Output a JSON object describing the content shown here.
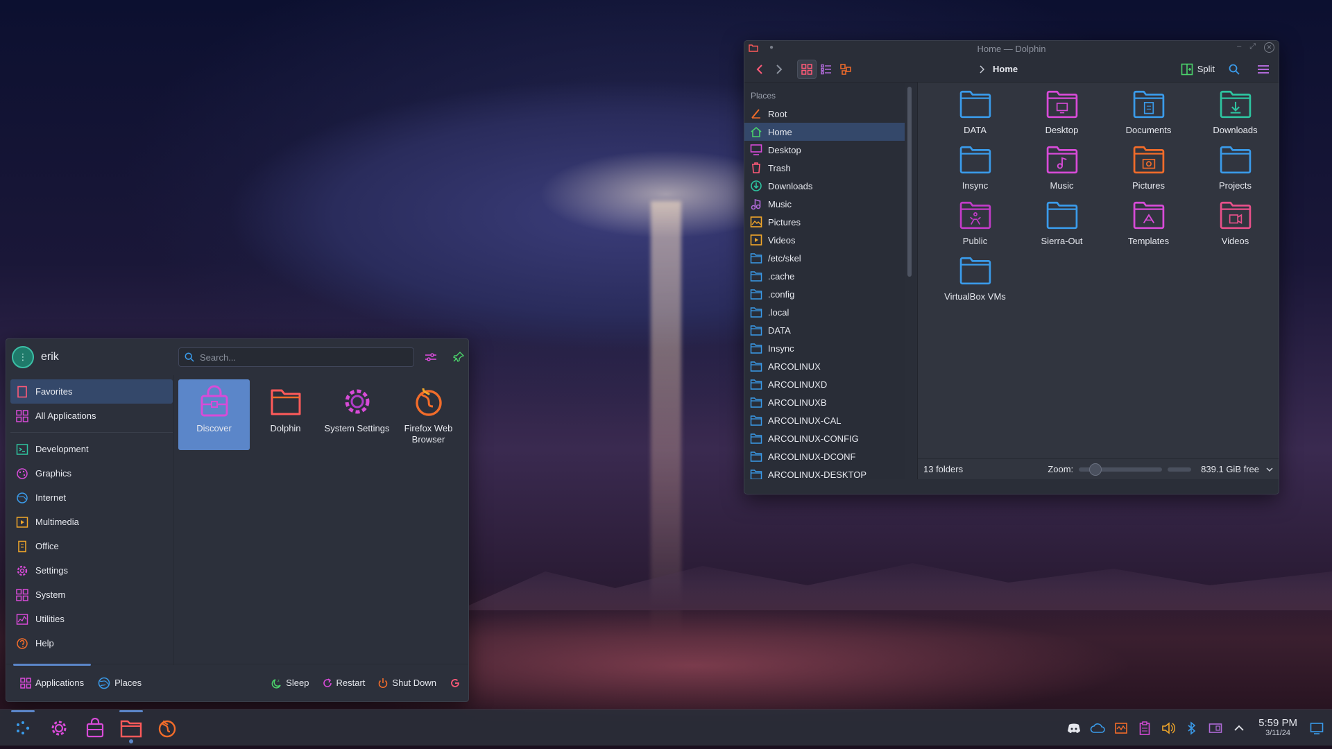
{
  "colors": {
    "accent": "#5b86c9",
    "folder_blue": "#3a9bea",
    "folder_pink": "#d84bd8",
    "folder_orange": "#f26c2a",
    "folder_teal": "#2ec4a0"
  },
  "dolphin": {
    "title": "Home — Dolphin",
    "breadcrumb": "Home",
    "split_label": "Split",
    "places_header": "Places",
    "places": [
      {
        "label": "Root",
        "icon": "root-icon"
      },
      {
        "label": "Home",
        "icon": "home-icon",
        "selected": true
      },
      {
        "label": "Desktop",
        "icon": "desktop-icon"
      },
      {
        "label": "Trash",
        "icon": "trash-icon"
      },
      {
        "label": "Downloads",
        "icon": "downloads-icon"
      },
      {
        "label": "Music",
        "icon": "music-icon"
      },
      {
        "label": "Pictures",
        "icon": "pictures-icon"
      },
      {
        "label": "Videos",
        "icon": "videos-icon"
      },
      {
        "label": "/etc/skel",
        "icon": "folder-icon"
      },
      {
        "label": ".cache",
        "icon": "folder-icon"
      },
      {
        "label": ".config",
        "icon": "folder-icon"
      },
      {
        "label": ".local",
        "icon": "folder-icon"
      },
      {
        "label": "DATA",
        "icon": "folder-icon"
      },
      {
        "label": "Insync",
        "icon": "folder-icon"
      },
      {
        "label": "ARCOLINUX",
        "icon": "folder-icon"
      },
      {
        "label": "ARCOLINUXD",
        "icon": "folder-icon"
      },
      {
        "label": "ARCOLINUXB",
        "icon": "folder-icon"
      },
      {
        "label": "ARCOLINUX-CAL",
        "icon": "folder-icon"
      },
      {
        "label": "ARCOLINUX-CONFIG",
        "icon": "folder-icon"
      },
      {
        "label": "ARCOLINUX-DCONF",
        "icon": "folder-icon"
      },
      {
        "label": "ARCOLINUX-DESKTOP",
        "icon": "folder-icon"
      }
    ],
    "files": [
      {
        "name": "DATA",
        "icon": "folder-icon",
        "color": "#3a9bea"
      },
      {
        "name": "Desktop",
        "icon": "folder-desktop-icon",
        "color": "#d84bd8"
      },
      {
        "name": "Documents",
        "icon": "folder-documents-icon",
        "color": "#3a9bea"
      },
      {
        "name": "Downloads",
        "icon": "folder-downloads-icon",
        "color": "#2ec4a0"
      },
      {
        "name": "Insync",
        "icon": "folder-icon",
        "color": "#3a9bea"
      },
      {
        "name": "Music",
        "icon": "folder-music-icon",
        "color": "#d84bd8"
      },
      {
        "name": "Pictures",
        "icon": "folder-pictures-icon",
        "color": "#f26c2a"
      },
      {
        "name": "Projects",
        "icon": "folder-icon",
        "color": "#3a9bea"
      },
      {
        "name": "Public",
        "icon": "folder-public-icon",
        "color": "#c23cc8"
      },
      {
        "name": "Sierra-Out",
        "icon": "folder-icon",
        "color": "#3a9bea"
      },
      {
        "name": "Templates",
        "icon": "folder-templates-icon",
        "color": "#d84bd8"
      },
      {
        "name": "Videos",
        "icon": "folder-videos-icon",
        "color": "#e8508a"
      },
      {
        "name": "VirtualBox VMs",
        "icon": "folder-icon",
        "color": "#3a9bea"
      }
    ],
    "status_count": "13 folders",
    "zoom_label": "Zoom:",
    "zoom_level": 0.15,
    "free_space": "839.1 GiB free"
  },
  "launcher": {
    "username": "erik",
    "search_placeholder": "Search...",
    "categories_top": [
      {
        "label": "Favorites",
        "icon": "bookmark-icon",
        "selected": true
      },
      {
        "label": "All Applications",
        "icon": "grid-icon"
      }
    ],
    "categories": [
      {
        "label": "Development",
        "icon": "development-icon",
        "color": "#2ec4a0"
      },
      {
        "label": "Graphics",
        "icon": "graphics-icon",
        "color": "#d84bd8"
      },
      {
        "label": "Internet",
        "icon": "internet-icon",
        "color": "#3a9bea"
      },
      {
        "label": "Multimedia",
        "icon": "multimedia-icon",
        "color": "#f2a72a"
      },
      {
        "label": "Office",
        "icon": "office-icon",
        "color": "#f2a72a"
      },
      {
        "label": "Settings",
        "icon": "settings-icon",
        "color": "#d84bd8"
      },
      {
        "label": "System",
        "icon": "system-icon",
        "color": "#d84bd8"
      },
      {
        "label": "Utilities",
        "icon": "utilities-icon",
        "color": "#d84bd8"
      },
      {
        "label": "Help",
        "icon": "help-icon",
        "color": "#f26c2a"
      }
    ],
    "favorites": [
      {
        "label": "Discover",
        "icon": "discover-icon",
        "selected": true
      },
      {
        "label": "Dolphin",
        "icon": "dolphin-icon"
      },
      {
        "label": "System Settings",
        "icon": "system-settings-icon"
      },
      {
        "label": "Firefox Web Browser",
        "icon": "firefox-icon"
      }
    ],
    "footer": {
      "applications_label": "Applications",
      "places_label": "Places",
      "sleep_label": "Sleep",
      "restart_label": "Restart",
      "shutdown_label": "Shut Down"
    }
  },
  "taskbar": {
    "time": "5:59 PM",
    "date": "3/11/24"
  }
}
